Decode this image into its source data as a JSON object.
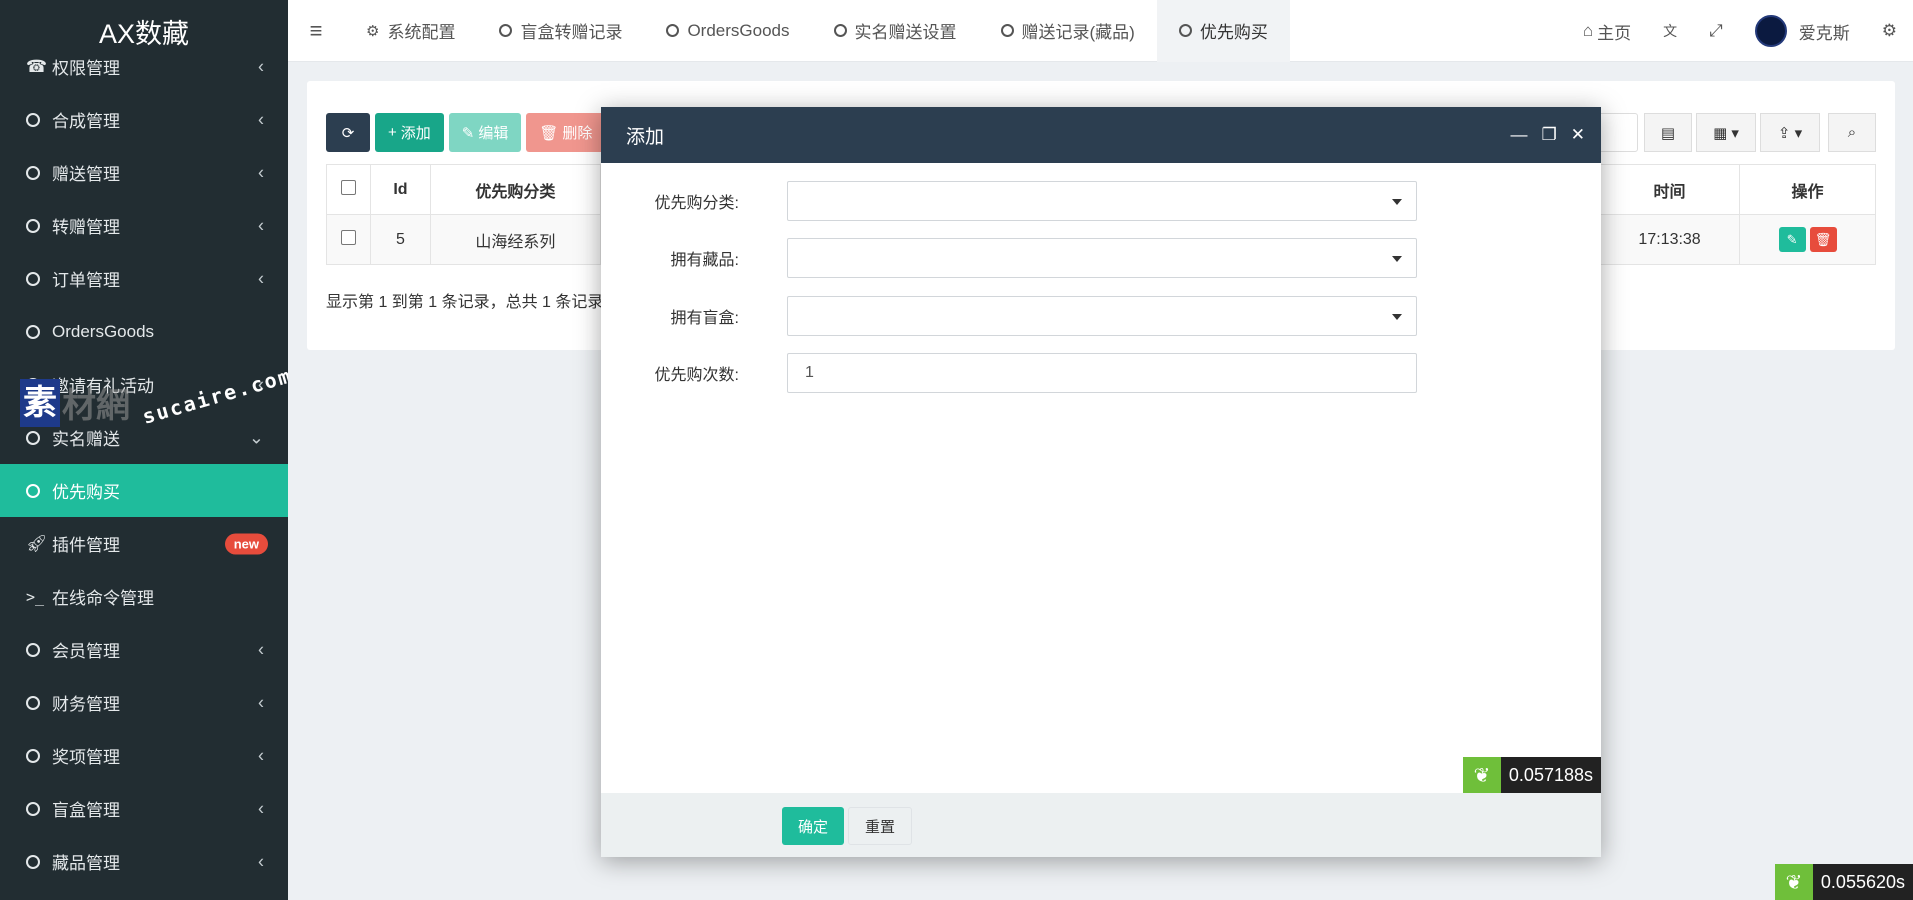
{
  "app": {
    "title": "AX数藏"
  },
  "sidebar": {
    "items": [
      {
        "label": "权限管理",
        "icon": "user-group-icon",
        "chevron": "‹"
      },
      {
        "label": "合成管理",
        "icon": "circle-icon",
        "chevron": "‹"
      },
      {
        "label": "赠送管理",
        "icon": "circle-icon",
        "chevron": "‹"
      },
      {
        "label": "转赠管理",
        "icon": "circle-icon",
        "chevron": "‹"
      },
      {
        "label": "订单管理",
        "icon": "circle-icon",
        "chevron": "‹"
      },
      {
        "label": "OrdersGoods",
        "icon": "circle-icon",
        "chevron": ""
      },
      {
        "label": "邀请有礼活动",
        "icon": "circle-icon",
        "chevron": "‹"
      },
      {
        "label": "实名赠送",
        "icon": "circle-icon",
        "chevron": "⌄"
      },
      {
        "label": "优先购买",
        "icon": "circle-icon",
        "chevron": "",
        "active": true
      },
      {
        "label": "插件管理",
        "icon": "rocket-icon",
        "badge": "new"
      },
      {
        "label": "在线命令管理",
        "icon": "terminal-icon",
        "chevron": ""
      },
      {
        "label": "会员管理",
        "icon": "circle-icon",
        "chevron": "‹"
      },
      {
        "label": "财务管理",
        "icon": "circle-icon",
        "chevron": "‹"
      },
      {
        "label": "奖项管理",
        "icon": "circle-icon",
        "chevron": "‹"
      },
      {
        "label": "盲盒管理",
        "icon": "circle-icon",
        "chevron": "‹"
      },
      {
        "label": "藏品管理",
        "icon": "circle-icon",
        "chevron": "‹"
      }
    ],
    "watermark": {
      "box": "素",
      "text": "材網",
      "url": "sucaire.com"
    }
  },
  "topbar": {
    "tabs": [
      {
        "label": "系统配置",
        "icon": "gear-icon"
      },
      {
        "label": "盲盒转赠记录",
        "icon": "circle-icon"
      },
      {
        "label": "OrdersGoods",
        "icon": "circle-icon"
      },
      {
        "label": "实名赠送设置",
        "icon": "circle-icon"
      },
      {
        "label": "赠送记录(藏品)",
        "icon": "circle-icon"
      },
      {
        "label": "优先购买",
        "icon": "circle-icon",
        "active": true
      }
    ],
    "home_label": "主页",
    "username": "爱克斯"
  },
  "toolbar": {
    "add_label": "添加",
    "edit_label": "编辑",
    "delete_label": "删除"
  },
  "table": {
    "headers": {
      "id": "Id",
      "category": "优先购分类",
      "time": "时间",
      "ops": "操作"
    },
    "rows": [
      {
        "id": "5",
        "category": "山海经系列",
        "time": "17:13:38"
      }
    ],
    "summary": "显示第 1 到第 1 条记录，总共 1 条记录"
  },
  "modal": {
    "title": "添加",
    "fields": [
      {
        "label": "优先购分类:",
        "type": "select",
        "value": ""
      },
      {
        "label": "拥有藏品:",
        "type": "select",
        "value": ""
      },
      {
        "label": "拥有盲盒:",
        "type": "select",
        "value": ""
      },
      {
        "label": "优先购次数:",
        "type": "input",
        "value": "1"
      }
    ],
    "ok_label": "确定",
    "reset_label": "重置"
  },
  "timers": {
    "modal": "0.057188s",
    "page": "0.055620s"
  },
  "colors": {
    "sidebar": "#222d32",
    "accent": "#1fbc9c",
    "modal_header": "#2c3e50",
    "danger": "#e74c3c"
  }
}
